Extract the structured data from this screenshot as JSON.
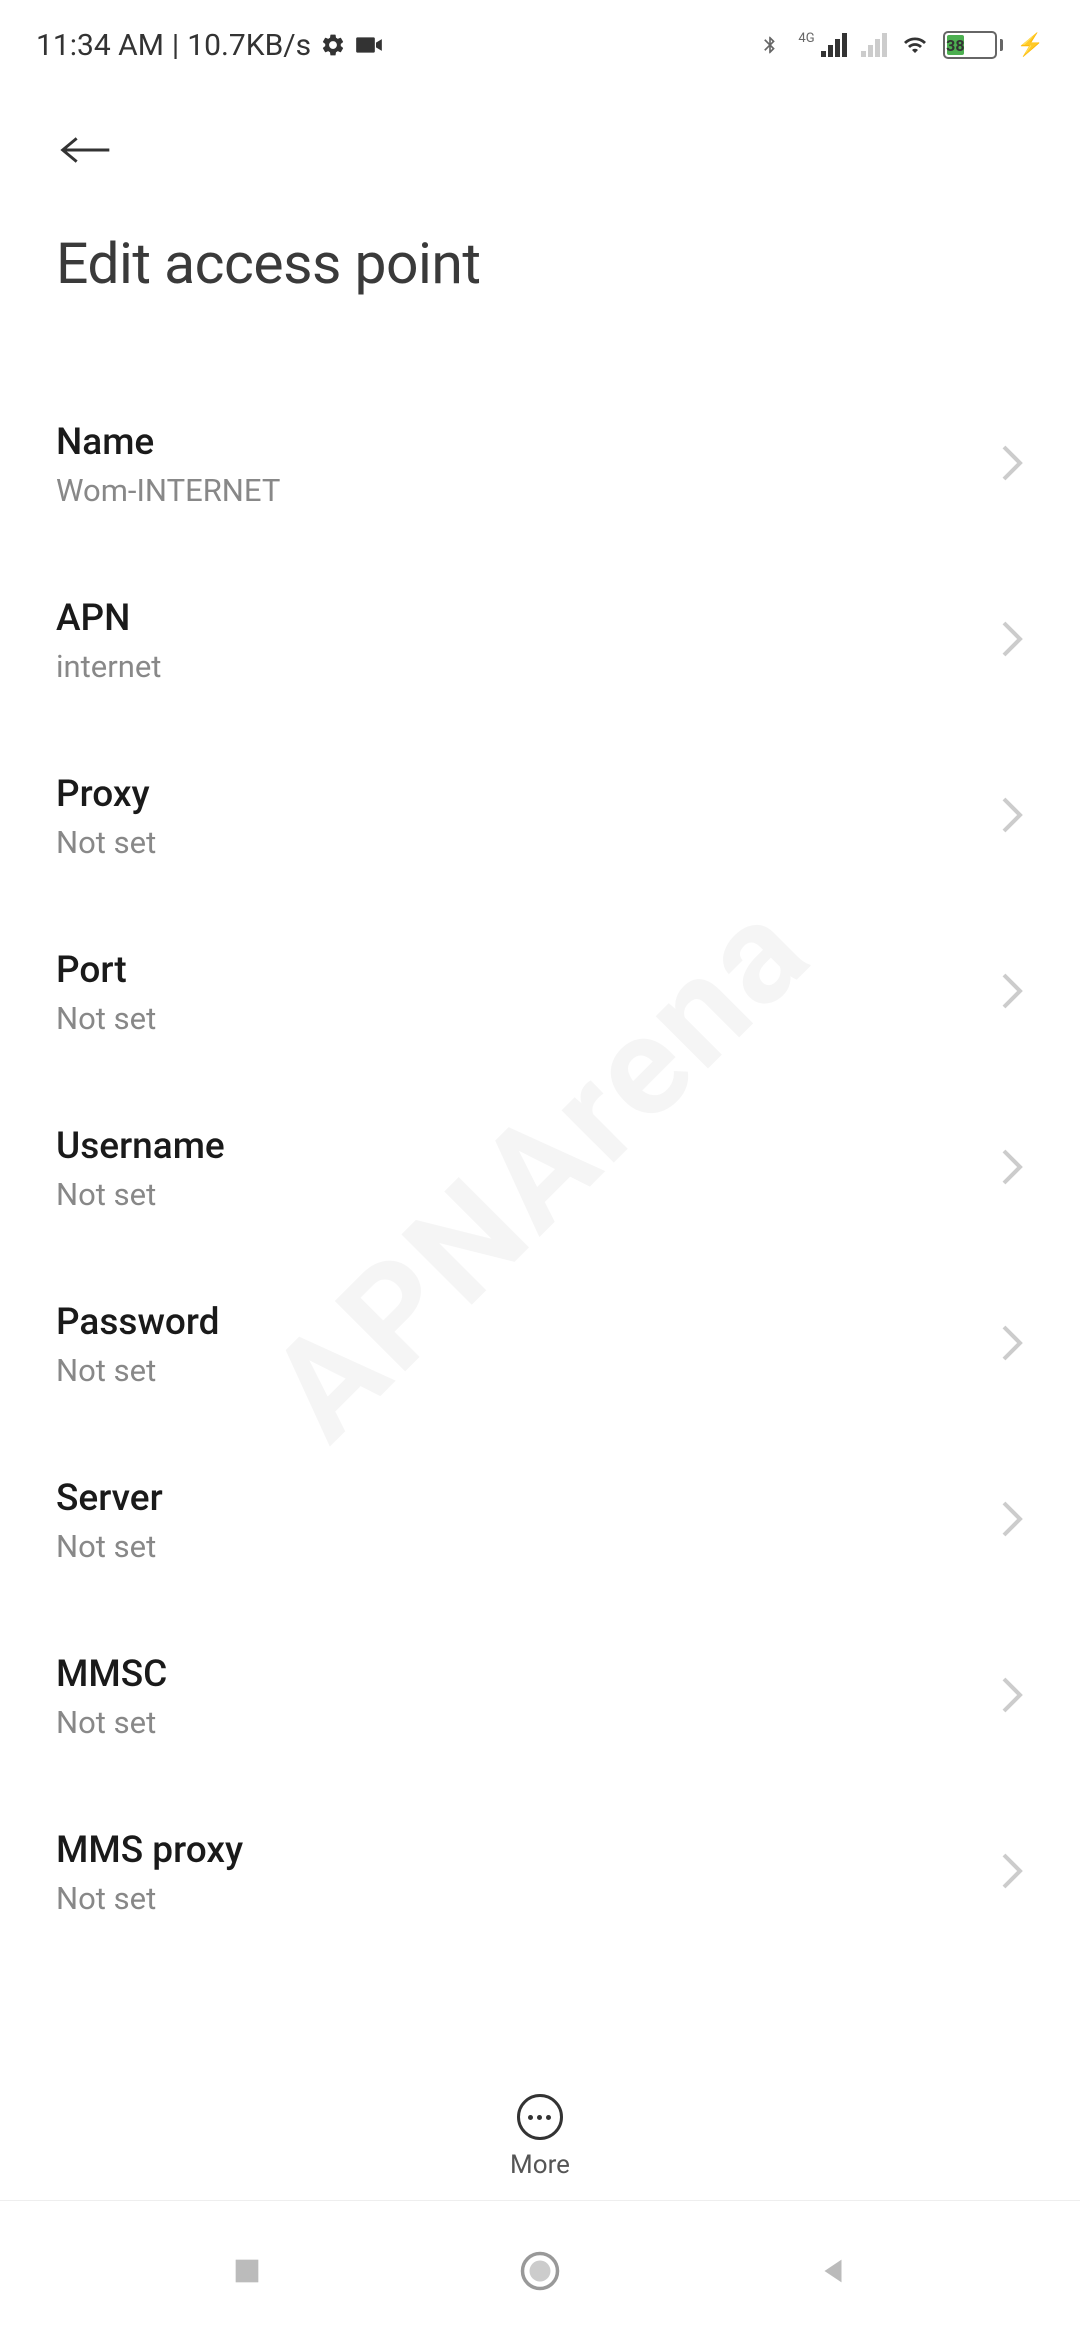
{
  "status": {
    "time": "11:34 AM",
    "speed": "10.7KB/s",
    "battery_level": "38",
    "network_type": "4G"
  },
  "page": {
    "title": "Edit access point"
  },
  "settings": [
    {
      "key": "name",
      "label": "Name",
      "value": "Wom-INTERNET"
    },
    {
      "key": "apn",
      "label": "APN",
      "value": "internet"
    },
    {
      "key": "proxy",
      "label": "Proxy",
      "value": "Not set"
    },
    {
      "key": "port",
      "label": "Port",
      "value": "Not set"
    },
    {
      "key": "username",
      "label": "Username",
      "value": "Not set"
    },
    {
      "key": "password",
      "label": "Password",
      "value": "Not set"
    },
    {
      "key": "server",
      "label": "Server",
      "value": "Not set"
    },
    {
      "key": "mmsc",
      "label": "MMSC",
      "value": "Not set"
    },
    {
      "key": "mms-proxy",
      "label": "MMS proxy",
      "value": "Not set"
    }
  ],
  "toolbar": {
    "more_label": "More"
  },
  "watermark": "APNArena"
}
